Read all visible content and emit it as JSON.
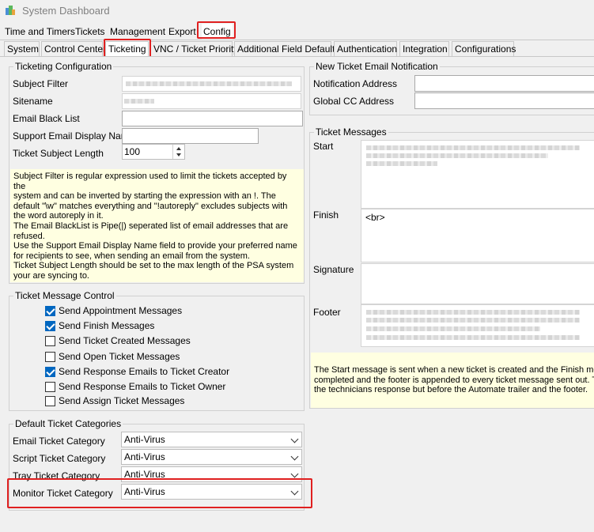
{
  "window": {
    "title": "System Dashboard"
  },
  "menu_tabs": [
    "Time and Timers",
    "Tickets",
    "Management",
    "Export",
    "Config"
  ],
  "sub_tabs": [
    "System",
    "Control Center",
    "Ticketing",
    "VNC / Ticket Priority",
    "Additional Field Defaults",
    "Authentication",
    "Integration",
    "Configurations"
  ],
  "ticketing_config": {
    "title": "Ticketing Configuration",
    "subject_filter_label": "Subject Filter",
    "sitename_label": "Sitename",
    "email_black_list_label": "Email Black List",
    "support_email_display_name_label": "Support Email Display Name",
    "ticket_subject_length_label": "Ticket Subject Length",
    "ticket_subject_length_value": "100",
    "help_lines": [
      "Subject Filter is regular expression used to limit the tickets accepted by the",
      "system and can be inverted by starting the expression with an !. The",
      "default \"\\w\" matches everything and \"!autoreply\" excludes subjects with",
      "the word autoreply in it.",
      "The Email BlackList is Pipe(|) seperated list of email addresses that are",
      "refused.",
      "Use the Support Email Display Name field to provide your preferred name",
      "for recipients to see, when sending an email from the system.",
      "Ticket Subject Length should be set to the max length of the PSA system",
      "your are syncing to."
    ]
  },
  "message_control": {
    "title": "Ticket Message Control",
    "items": [
      {
        "label": "Send Appointment Messages",
        "checked": true
      },
      {
        "label": "Send Finish Messages",
        "checked": true
      },
      {
        "label": "Send Ticket Created Messages",
        "checked": false
      },
      {
        "label": "Send Open Ticket Messages",
        "checked": false
      },
      {
        "label": "Send Response Emails to Ticket Creator",
        "checked": true
      },
      {
        "label": "Send Response Emails to Ticket Owner",
        "checked": false
      },
      {
        "label": "Send Assign Ticket Messages",
        "checked": false
      }
    ]
  },
  "categories": {
    "title": "Default Ticket Categories",
    "items": [
      {
        "label": "Email Ticket Category",
        "value": "Anti-Virus"
      },
      {
        "label": "Script Ticket Category",
        "value": "Anti-Virus"
      },
      {
        "label": "Tray Ticket Category",
        "value": "Anti-Virus"
      },
      {
        "label": "Monitor Ticket Category",
        "value": "Anti-Virus"
      }
    ]
  },
  "new_ticket_email": {
    "title": "New Ticket Email Notification",
    "notification_address_label": "Notification Address",
    "global_cc_label": "Global CC Address"
  },
  "ticket_messages": {
    "title": "Ticket Messages",
    "start_label": "Start",
    "finish_label": "Finish",
    "finish_value": "<br>",
    "signature_label": "Signature",
    "footer_label": "Footer",
    "help_lines": [
      "The Start message is sent when a new ticket is created and the Finish mes",
      "completed and the footer is appended to every ticket message sent out. T",
      "the technicians response but before the Automate trailer and the footer."
    ]
  },
  "colors": {
    "highlight": "#e02020",
    "note_bg": "#ffffe1",
    "checkbox": "#0067c0"
  }
}
